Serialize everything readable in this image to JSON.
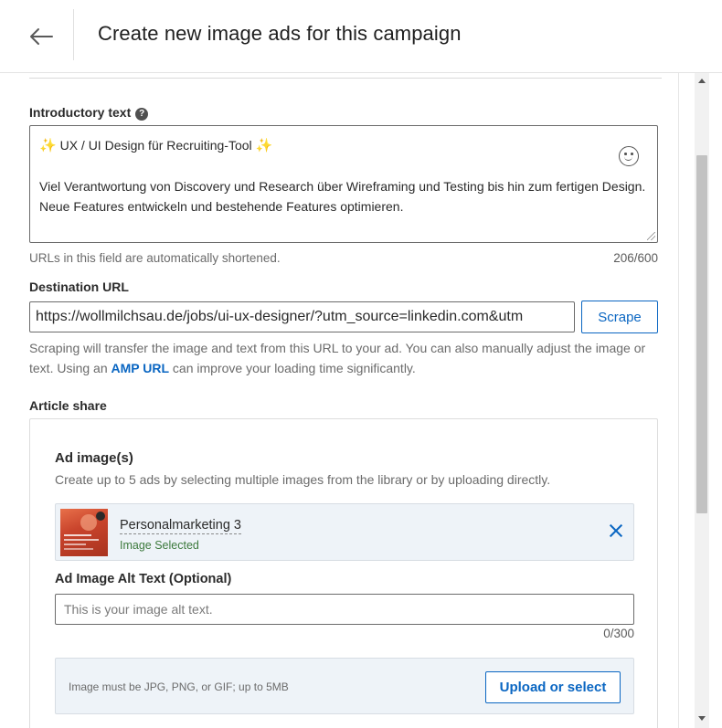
{
  "header": {
    "title": "Create new image ads for this campaign"
  },
  "intro": {
    "label": "Introductory text",
    "help_icon": "?",
    "line1_left_emoji": "✨",
    "line1_text": "UX / UI Design für Recruiting-Tool",
    "line1_right_emoji": "✨",
    "body": "Viel Verantwortung von Discovery und Research über Wireframing und Testing bis hin zum fertigen Design. Neue Features entwickeln und bestehende Features optimieren.",
    "hint": "URLs in this field are automatically shortened.",
    "counter": "206/600"
  },
  "destination": {
    "label": "Destination URL",
    "value": "https://wollmilchsau.de/jobs/ui-ux-designer/?utm_source=linkedin.com&utm",
    "scrape_label": "Scrape",
    "note_before": "Scraping will transfer the image and text from this URL to your ad. You can also manually adjust the image or text. Using an ",
    "note_link": "AMP URL",
    "note_after": " can improve your loading time significantly."
  },
  "article": {
    "label": "Article share",
    "ad_images_title": "Ad image(s)",
    "ad_images_sub": "Create up to 5 ads by selecting multiple images from the library or by uploading directly.",
    "selected_image": {
      "name": "Personalmarketing 3",
      "status": "Image Selected"
    },
    "alt_label": "Ad Image Alt Text (Optional)",
    "alt_placeholder": "This is your image alt text.",
    "alt_value": "",
    "alt_counter": "0/300",
    "upload_hint": "Image must be JPG, PNG, or GIF; up to 5MB",
    "upload_label": "Upload or select"
  },
  "colors": {
    "accent": "#0a66c2",
    "success": "#3d7a3d"
  },
  "icons": [
    "back-arrow-icon",
    "help-icon",
    "smiley-icon",
    "close-icon",
    "sparkle-icon"
  ]
}
